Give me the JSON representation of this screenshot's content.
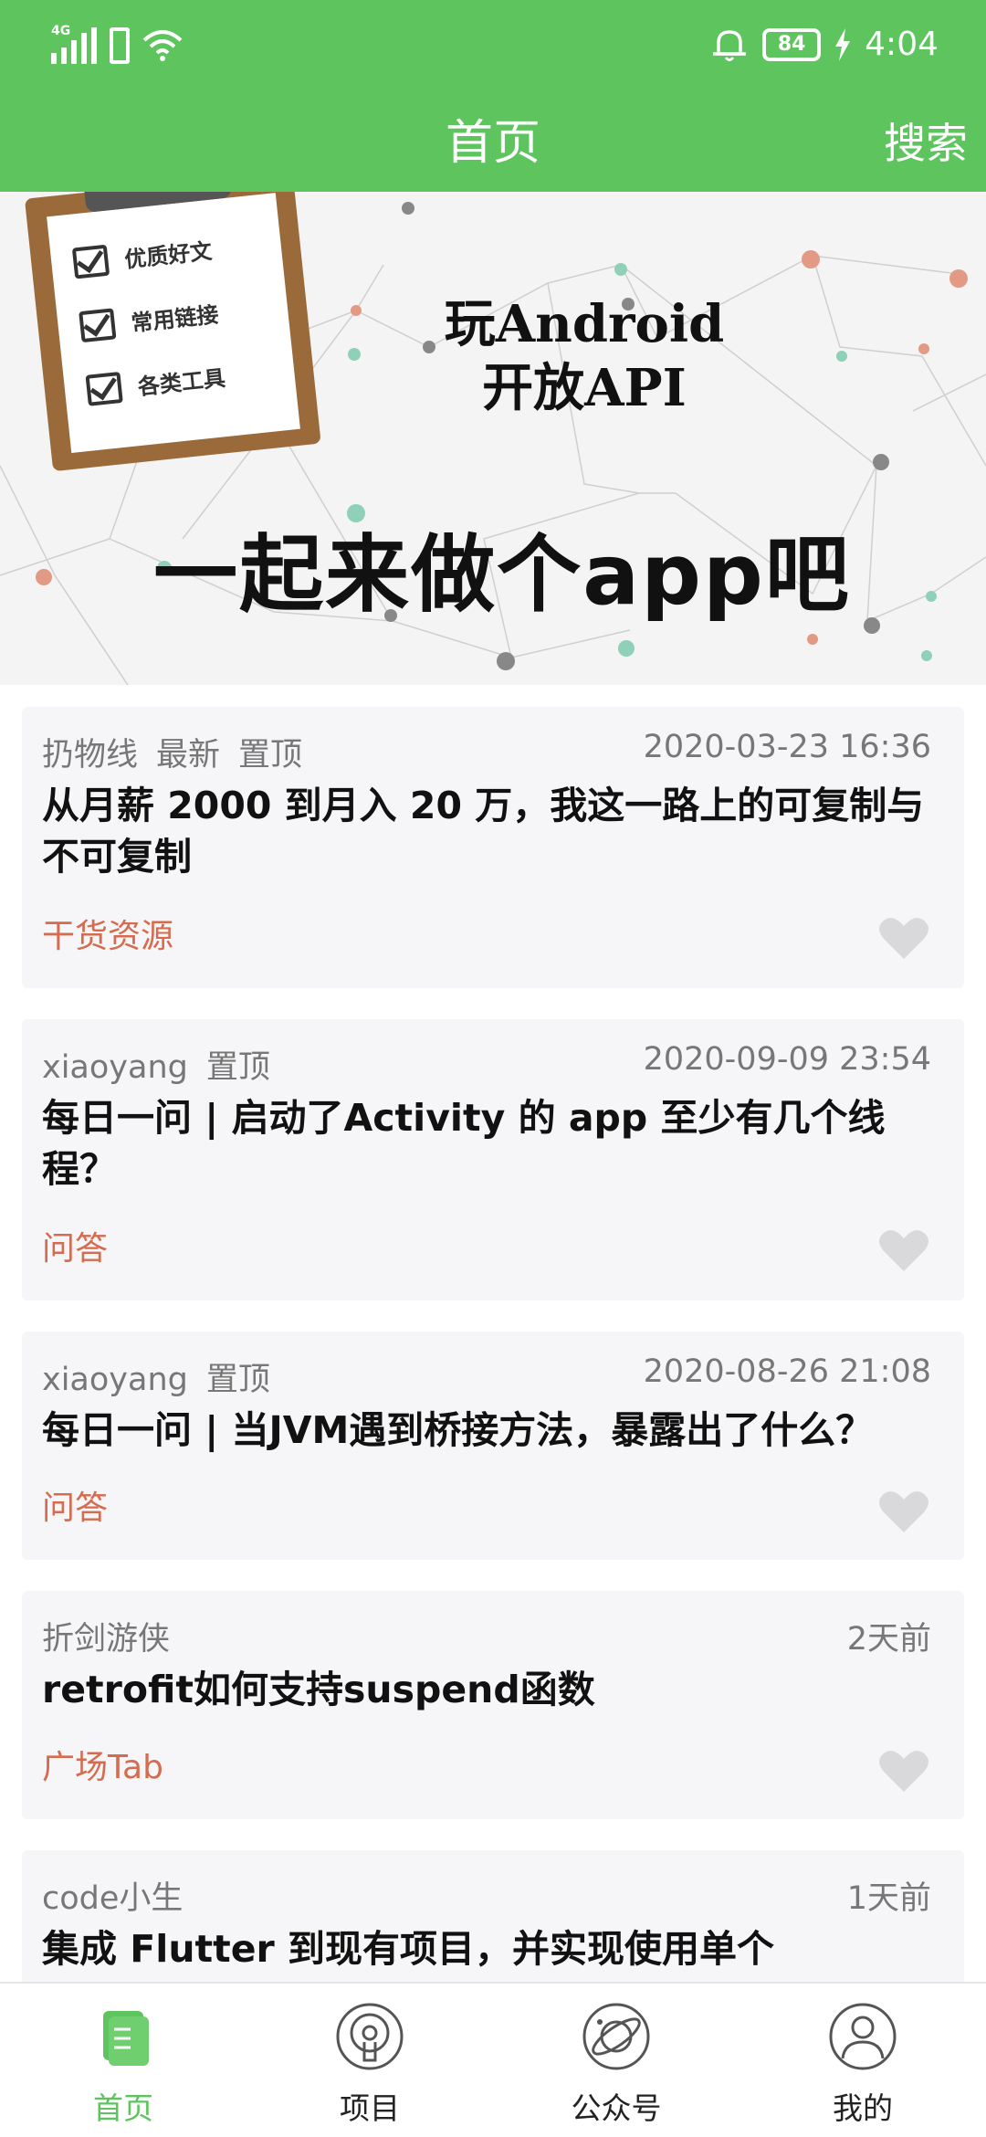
{
  "status_bar": {
    "network": "4G",
    "battery": "84",
    "time": "4:04"
  },
  "header": {
    "title": "首页",
    "search_label": "搜索"
  },
  "banner": {
    "clipboard_items": [
      "优质好文",
      "常用链接",
      "各类工具"
    ],
    "title_line1": "玩Android",
    "title_line2": "开放API",
    "slogan": "一起来做个app吧"
  },
  "articles": [
    {
      "author": "扔物线",
      "tags": [
        "最新",
        "置顶"
      ],
      "time": "2020-03-23 16:36",
      "title": "从月薪 2000 到月入 20 万，我这一路上的可复制与不可复制",
      "chapter": "干货资源"
    },
    {
      "author": "xiaoyang",
      "tags": [
        "置顶"
      ],
      "time": "2020-09-09 23:54",
      "title": "每日一问 | 启动了Activity 的 app 至少有几个线程？",
      "chapter": "问答"
    },
    {
      "author": "xiaoyang",
      "tags": [
        "置顶"
      ],
      "time": "2020-08-26 21:08",
      "title": "每日一问 | 当JVM遇到桥接方法，暴露出了什么？",
      "chapter": "问答"
    },
    {
      "author": "折剑游侠",
      "tags": [],
      "time": "2天前",
      "title": "retrofit如何支持suspend函数",
      "chapter": "广场Tab"
    },
    {
      "author": "code小生",
      "tags": [],
      "time": "1天前",
      "title": "集成 Flutter 到现有项目，并实现使用单个",
      "chapter": ""
    }
  ],
  "bottom_nav": {
    "items": [
      {
        "label": "首页",
        "icon": "home-icon",
        "active": true
      },
      {
        "label": "项目",
        "icon": "project-icon",
        "active": false
      },
      {
        "label": "公众号",
        "icon": "planet-icon",
        "active": false
      },
      {
        "label": "我的",
        "icon": "user-icon",
        "active": false
      }
    ]
  },
  "colors": {
    "accent": "#5ec45e",
    "chapter": "#d56b4f",
    "card_bg": "#f6f6f8"
  }
}
